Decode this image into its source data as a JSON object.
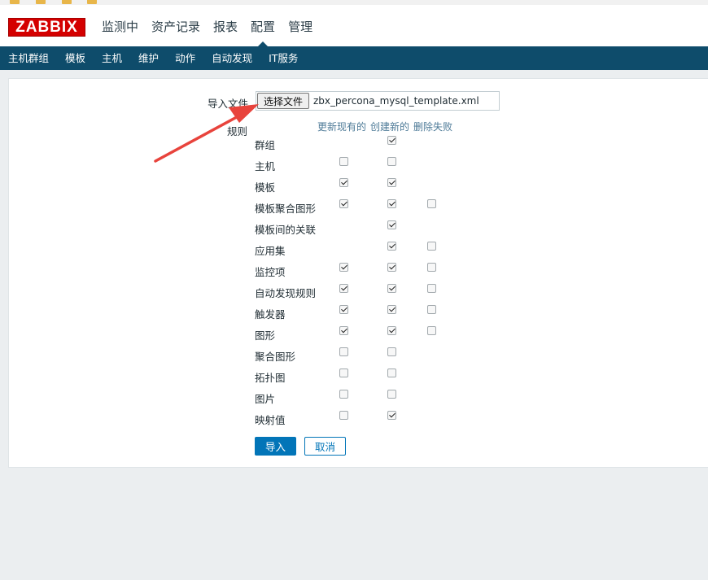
{
  "header": {
    "logo_text": "ZABBIX",
    "menu": [
      {
        "label": "监测中"
      },
      {
        "label": "资产记录"
      },
      {
        "label": "报表"
      },
      {
        "label": "配置",
        "selected": true
      },
      {
        "label": "管理"
      }
    ]
  },
  "subnav": [
    {
      "label": "主机群组"
    },
    {
      "label": "模板"
    },
    {
      "label": "主机"
    },
    {
      "label": "维护"
    },
    {
      "label": "动作"
    },
    {
      "label": "自动发现"
    },
    {
      "label": "IT服务"
    }
  ],
  "import_form": {
    "file_label": "导入文件",
    "choose_button": "选择文件",
    "file_name": "zbx_percona_mysql_template.xml",
    "rules_label": "规则",
    "columns": {
      "update_existing": "更新现有的",
      "create_new": "创建新的",
      "delete_missing": "删除失败"
    },
    "rules": [
      {
        "name": "群组",
        "update": null,
        "create": true,
        "delete": null
      },
      {
        "name": "主机",
        "update": false,
        "create": false,
        "delete": null
      },
      {
        "name": "模板",
        "update": true,
        "create": true,
        "delete": null
      },
      {
        "name": "模板聚合图形",
        "update": true,
        "create": true,
        "delete": false
      },
      {
        "name": "模板间的关联",
        "update": null,
        "create": true,
        "delete": null
      },
      {
        "name": "应用集",
        "update": null,
        "create": true,
        "delete": false
      },
      {
        "name": "监控项",
        "update": true,
        "create": true,
        "delete": false
      },
      {
        "name": "自动发现规则",
        "update": true,
        "create": true,
        "delete": false
      },
      {
        "name": "触发器",
        "update": true,
        "create": true,
        "delete": false
      },
      {
        "name": "图形",
        "update": true,
        "create": true,
        "delete": false
      },
      {
        "name": "聚合图形",
        "update": false,
        "create": false,
        "delete": null
      },
      {
        "name": "拓扑图",
        "update": false,
        "create": false,
        "delete": null
      },
      {
        "name": "图片",
        "update": false,
        "create": false,
        "delete": null
      },
      {
        "name": "映射值",
        "update": false,
        "create": true,
        "delete": null
      }
    ],
    "import_button": "导入",
    "cancel_button": "取消"
  },
  "colors": {
    "brand_red": "#d40000",
    "nav_blue": "#0e4c6b",
    "primary_button": "#0275b8",
    "annotation_arrow": "#e8433c"
  }
}
